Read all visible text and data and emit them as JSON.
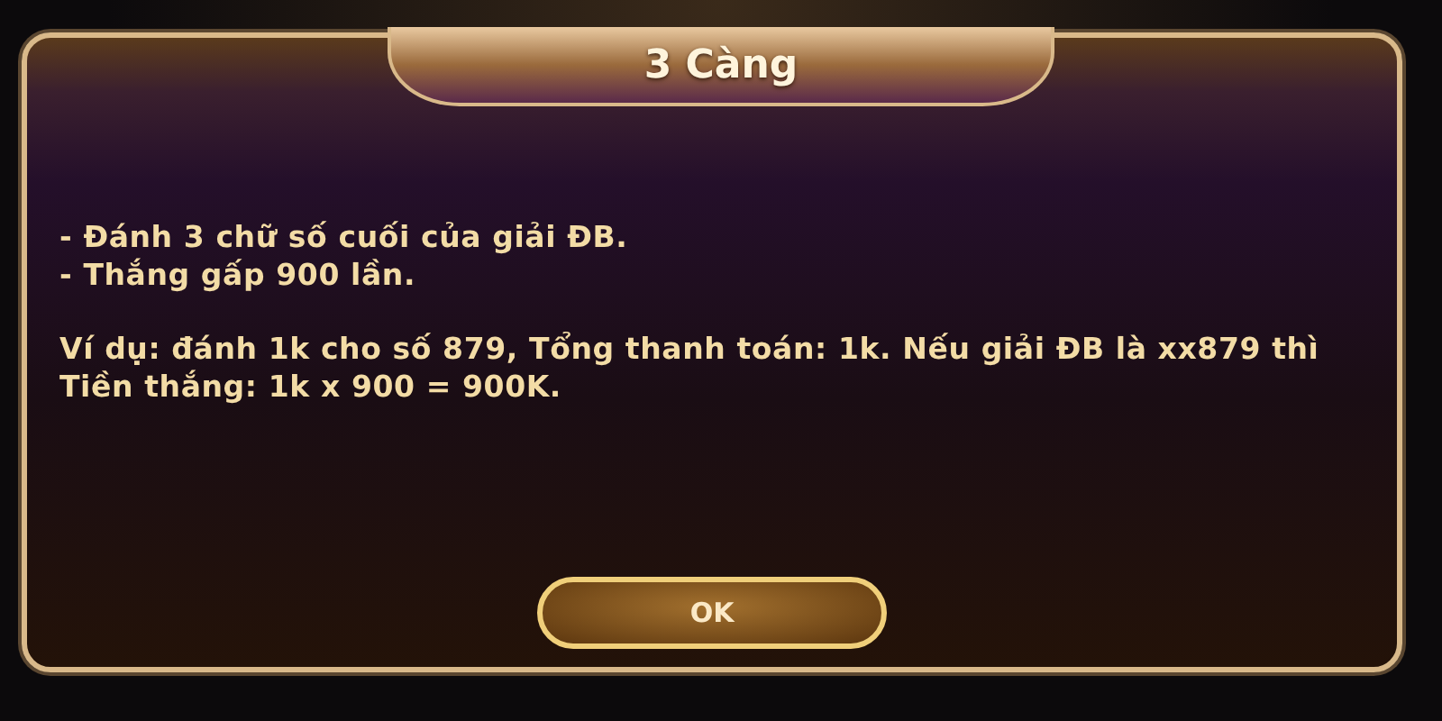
{
  "dialog": {
    "title": "3 Càng",
    "rules": [
      "- Đánh 3 chữ số cuối của giải ĐB.",
      "- Thắng gấp 900 lần."
    ],
    "example": "Ví dụ: đánh 1k cho số 879, Tổng thanh toán: 1k. Nếu giải ĐB là xx879 thì Tiền thắng: 1k x 900 = 900K.",
    "button": "OK"
  }
}
